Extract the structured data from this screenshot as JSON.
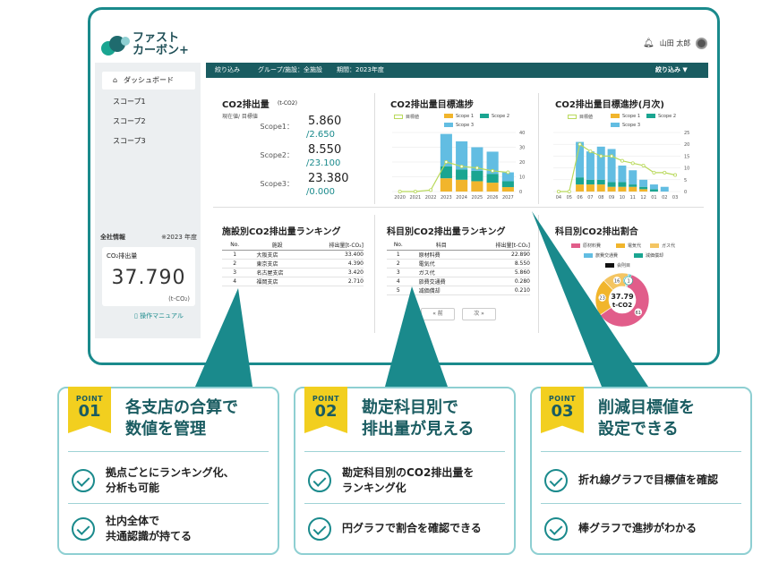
{
  "app": {
    "logo_line1": "ファスト",
    "logo_line2": "カーボン+",
    "user_name": "山田 太郎"
  },
  "sidebar": {
    "items": [
      {
        "label": "ダッシュボード",
        "icon": "home-icon"
      },
      {
        "label": "スコープ1"
      },
      {
        "label": "スコープ2"
      },
      {
        "label": "スコープ3"
      }
    ],
    "info_label": "全社情報",
    "info_year": "※2023 年度",
    "kpi_label": "CO₂排出量",
    "kpi_value": "37.790",
    "kpi_unit": "(t-CO₂)",
    "manual_label": "操作マニュアル"
  },
  "filterbar": {
    "label": "絞り込み",
    "group": "グループ/施設：全施設",
    "period": "期間：2023年度",
    "dropdown": "絞り込み ▼"
  },
  "co2_card": {
    "title": "CO2排出量",
    "unit": "(t-CO2)",
    "legend": "現在値/ 目標値",
    "scopes": [
      {
        "name": "Scope1：",
        "value": "5.860",
        "target": "/2.650"
      },
      {
        "name": "Scope2：",
        "value": "8.550",
        "target": "/23.100"
      },
      {
        "name": "Scope3：",
        "value": "23.380",
        "target": "/0.000"
      }
    ]
  },
  "target_card": {
    "title": "CO2排出量目標進捗"
  },
  "monthly_card": {
    "title": "CO2排出量目標進捗(月次)"
  },
  "facility_card": {
    "title": "施設別CO2排出量ランキング",
    "headers": [
      "No.",
      "施設",
      "排出量[t-CO₂]"
    ],
    "rows": [
      [
        "1",
        "大阪支店",
        "33.400"
      ],
      [
        "2",
        "東京支店",
        "4.390"
      ],
      [
        "3",
        "名古屋支店",
        "3.420"
      ],
      [
        "4",
        "福岡支店",
        "2.710"
      ]
    ]
  },
  "account_card": {
    "title": "科目別CO2排出量ランキング",
    "headers": [
      "No.",
      "科目",
      "排出量[t-CO₂]"
    ],
    "rows": [
      [
        "1",
        "原材料費",
        "22.890"
      ],
      [
        "2",
        "電気代",
        "8.550"
      ],
      [
        "3",
        "ガス代",
        "5.860"
      ],
      [
        "4",
        "旅費交通費",
        "0.280"
      ],
      [
        "5",
        "减価償却",
        "0.210"
      ]
    ],
    "prev": "« 前",
    "next": "次 »"
  },
  "share_card": {
    "title": "科目別CO2排出割合",
    "legend": [
      "原材料費",
      "電気代",
      "ガス代",
      "旅費交通費",
      "減価償却",
      "会則目"
    ],
    "center_value": "37.79",
    "center_unit": "t-CO2",
    "labels": [
      "61",
      "23",
      "16",
      "1",
      "1"
    ]
  },
  "chart_data": [
    {
      "type": "bar",
      "title": "CO2排出量目標進捗",
      "categories": [
        "2020",
        "2021",
        "2022",
        "2023",
        "2024",
        "2025",
        "2026",
        "2027"
      ],
      "series": [
        {
          "name": "Scope 1",
          "values": [
            0,
            0,
            0,
            9,
            8,
            7,
            6,
            3
          ]
        },
        {
          "name": "Scope 2",
          "values": [
            0,
            0,
            0,
            8,
            7,
            7,
            6,
            4
          ]
        },
        {
          "name": "Scope 3",
          "values": [
            0,
            0,
            0,
            22,
            19,
            16,
            15,
            6
          ]
        },
        {
          "name": "目標値",
          "values": [
            0,
            0,
            1,
            20,
            17,
            16,
            14,
            13
          ]
        }
      ],
      "ylim": [
        0,
        40
      ],
      "yticks": [
        "0",
        "10",
        "20",
        "30",
        "40"
      ]
    },
    {
      "type": "bar",
      "title": "CO2排出量目標進捗(月次)",
      "categories": [
        "04",
        "05",
        "06",
        "07",
        "08",
        "09",
        "10",
        "11",
        "12",
        "01",
        "02",
        "03"
      ],
      "series": [
        {
          "name": "Scope 1",
          "values": [
            0,
            0,
            3,
            3,
            3,
            2,
            2,
            2,
            1,
            0,
            0,
            0
          ]
        },
        {
          "name": "Scope 2",
          "values": [
            0,
            0,
            3,
            2,
            2,
            2,
            2,
            1,
            1,
            1,
            0,
            0
          ]
        },
        {
          "name": "Scope 3",
          "values": [
            0,
            0,
            15,
            12,
            14,
            14,
            7,
            6,
            3,
            2,
            2,
            0
          ]
        },
        {
          "name": "目標値",
          "values": [
            0,
            0,
            20,
            17,
            15,
            15,
            13,
            12,
            11,
            8,
            8,
            7
          ]
        }
      ],
      "ylim": [
        0,
        25
      ],
      "yticks": [
        "0",
        "5",
        "10",
        "15",
        "20",
        "25"
      ]
    },
    {
      "type": "pie",
      "title": "科目別CO2排出割合",
      "categories": [
        "原材料費",
        "電気代",
        "ガス代",
        "旅費交通費",
        "減価償却"
      ],
      "values": [
        61,
        23,
        16,
        1,
        1
      ]
    }
  ],
  "points": [
    {
      "tag": "POINT",
      "num": "01",
      "title1": "各支店の合算で",
      "title2": "数値を管理",
      "items": [
        [
          "拠点ごとにランキング化、",
          "分析も可能"
        ],
        [
          "社内全体で",
          "共通認識が持てる"
        ]
      ]
    },
    {
      "tag": "POINT",
      "num": "02",
      "title1": "勘定科目別で",
      "title2": "排出量が見える",
      "items": [
        [
          "勘定科目別のCO2排出量を",
          "ランキング化"
        ],
        [
          "円グラフで割合を確認できる"
        ]
      ]
    },
    {
      "tag": "POINT",
      "num": "03",
      "title1": "削減目標値を",
      "title2": "設定できる",
      "items": [
        [
          "折れ線グラフで目標値を確認"
        ],
        [
          "棒グラフで進捗がわかる"
        ]
      ]
    }
  ],
  "colors": {
    "scope1": "#f1b52c",
    "scope2": "#1aa591",
    "scope3": "#62bde2",
    "target": "#b9d95b",
    "teal": "#1a8a8c",
    "pie": [
      "#e15d8a",
      "#f1b52c",
      "#f4c562",
      "#62bde2",
      "#1aa591"
    ]
  }
}
